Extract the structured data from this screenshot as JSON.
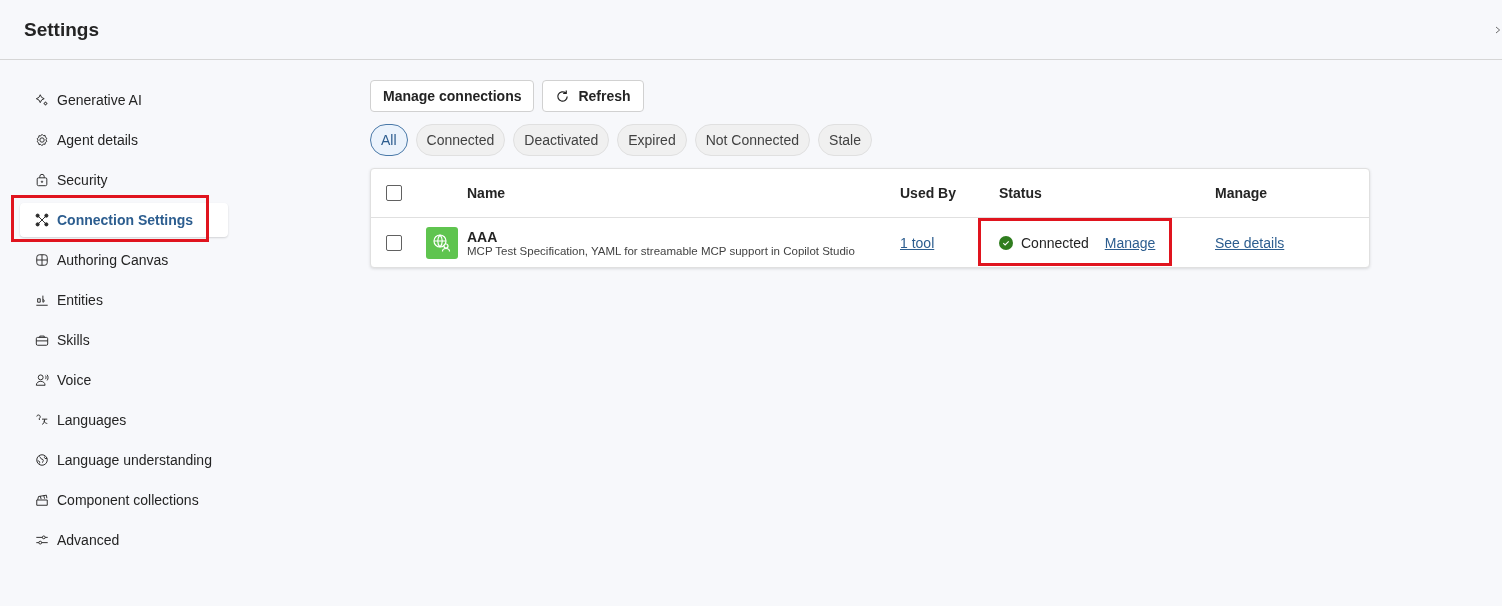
{
  "window": {
    "title": "Settings"
  },
  "sidebar": {
    "items": [
      {
        "label": "Generative AI",
        "selected": false,
        "highlighted": false
      },
      {
        "label": "Agent details",
        "selected": false,
        "highlighted": false
      },
      {
        "label": "Security",
        "selected": false,
        "highlighted": false
      },
      {
        "label": "Connection Settings",
        "selected": true,
        "highlighted": true
      },
      {
        "label": "Authoring Canvas",
        "selected": false,
        "highlighted": false
      },
      {
        "label": "Entities",
        "selected": false,
        "highlighted": false
      },
      {
        "label": "Skills",
        "selected": false,
        "highlighted": false
      },
      {
        "label": "Voice",
        "selected": false,
        "highlighted": false
      },
      {
        "label": "Languages",
        "selected": false,
        "highlighted": false
      },
      {
        "label": "Language understanding",
        "selected": false,
        "highlighted": false
      },
      {
        "label": "Component collections",
        "selected": false,
        "highlighted": false
      },
      {
        "label": "Advanced",
        "selected": false,
        "highlighted": false
      }
    ]
  },
  "toolbar": {
    "buttons": [
      "Manage connections",
      "Refresh"
    ]
  },
  "filters": [
    {
      "label": "All",
      "selected": true
    },
    {
      "label": "Connected",
      "selected": false
    },
    {
      "label": "Deactivated",
      "selected": false
    },
    {
      "label": "Expired",
      "selected": false
    },
    {
      "label": "Not Connected",
      "selected": false
    },
    {
      "label": "Stale",
      "selected": false
    }
  ],
  "table": {
    "select_all_checked": false,
    "columns": [
      "Name",
      "Used By",
      "Status",
      "Manage"
    ],
    "rows": [
      {
        "checked": false,
        "name": "AAA",
        "description": "MCP Test Specification, YAML for streamable MCP support in Copilot Studio",
        "used_by": "1 tool",
        "status": "Connected",
        "status_action": "Manage",
        "status_highlighted": true,
        "manage": "See details"
      }
    ]
  }
}
